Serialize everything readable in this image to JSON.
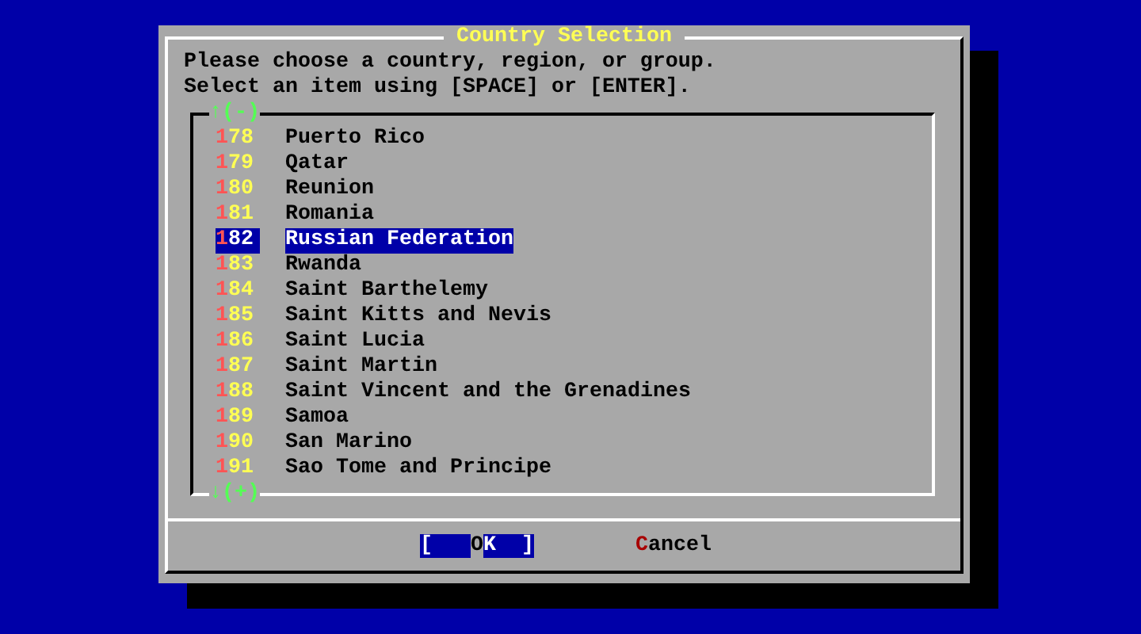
{
  "dialog": {
    "title": "Country Selection",
    "prompt": [
      "Please choose a country, region, or group.",
      "Select an item using [SPACE] or [ENTER]."
    ],
    "scroll_up": "↑(-)",
    "scroll_down": "↓(+)",
    "items": [
      {
        "tag": "178",
        "name": "Puerto Rico",
        "selected": false
      },
      {
        "tag": "179",
        "name": "Qatar",
        "selected": false
      },
      {
        "tag": "180",
        "name": "Reunion",
        "selected": false
      },
      {
        "tag": "181",
        "name": "Romania",
        "selected": false
      },
      {
        "tag": "182",
        "name": "Russian Federation",
        "selected": true
      },
      {
        "tag": "183",
        "name": "Rwanda",
        "selected": false
      },
      {
        "tag": "184",
        "name": "Saint Barthelemy",
        "selected": false
      },
      {
        "tag": "185",
        "name": "Saint Kitts and Nevis",
        "selected": false
      },
      {
        "tag": "186",
        "name": "Saint Lucia",
        "selected": false
      },
      {
        "tag": "187",
        "name": "Saint Martin",
        "selected": false
      },
      {
        "tag": "188",
        "name": "Saint Vincent and the Grenadines",
        "selected": false
      },
      {
        "tag": "189",
        "name": "Samoa",
        "selected": false
      },
      {
        "tag": "190",
        "name": "San Marino",
        "selected": false
      },
      {
        "tag": "191",
        "name": "Sao Tome and Principe",
        "selected": false
      }
    ],
    "buttons": [
      {
        "open": "[",
        "label": "OK",
        "close": "]",
        "selected": true
      },
      {
        "label": "Cancel",
        "selected": false
      }
    ]
  }
}
